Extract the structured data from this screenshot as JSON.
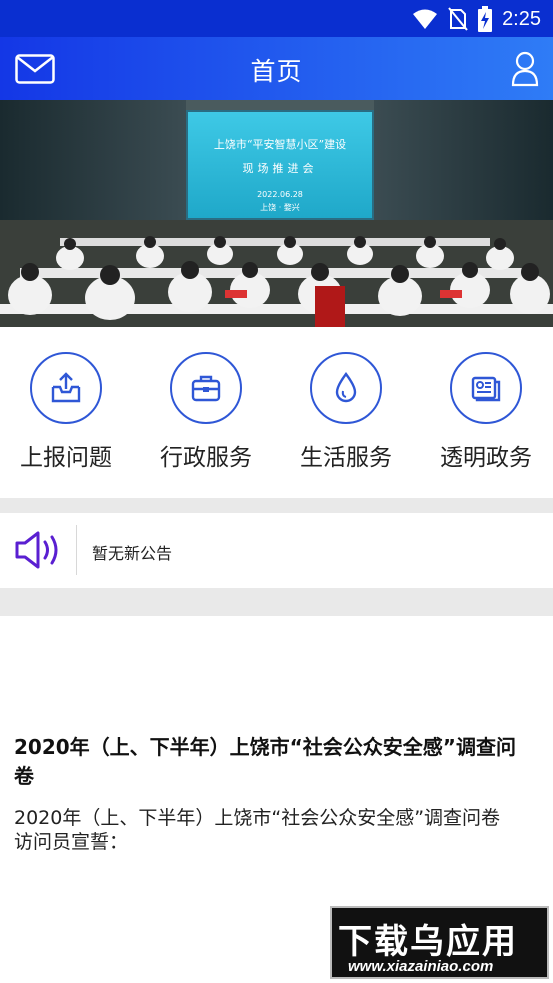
{
  "status_bar": {
    "time": "2:25"
  },
  "app_bar": {
    "title": "首页",
    "mail_icon": "mail-icon",
    "user_icon": "user-icon"
  },
  "banner": {
    "screen_line1": "上饶市“平安智慧小区”建设",
    "screen_line2": "现场推进会",
    "screen_date": "2022.06.28",
    "screen_place": "上饶 · 婺兴",
    "slides": 2,
    "active_slide": 1
  },
  "quick_actions": [
    {
      "label": "上报问题",
      "icon": "upload-tray-icon"
    },
    {
      "label": "行政服务",
      "icon": "briefcase-icon"
    },
    {
      "label": "生活服务",
      "icon": "water-drop-icon"
    },
    {
      "label": "透明政务",
      "icon": "document-chart-icon"
    }
  ],
  "notice": {
    "text": "暂无新公告",
    "icon": "speaker-icon"
  },
  "article": {
    "title": "2020年（上、下半年）上饶市“社会公众安全感”调查问卷",
    "body_line1": "2020年（上、下半年）上饶市“社会公众安全感”调查问卷",
    "body_line2": "访问员宣誓："
  },
  "watermark": {
    "big": "下载乌应用",
    "small": "www.xiazainiao.com"
  },
  "colors": {
    "accent": "#2f57d6",
    "appbar_start": "#1437e6",
    "appbar_end": "#2f7cf6",
    "speaker": "#5a1fd1"
  }
}
